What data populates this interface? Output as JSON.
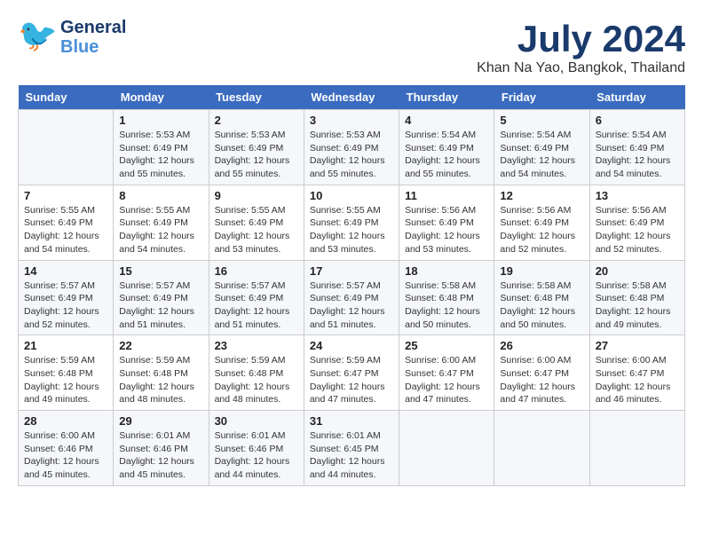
{
  "logo": {
    "line1": "General",
    "line2": "Blue"
  },
  "title": "July 2024",
  "subtitle": "Khan Na Yao, Bangkok, Thailand",
  "days_of_week": [
    "Sunday",
    "Monday",
    "Tuesday",
    "Wednesday",
    "Thursday",
    "Friday",
    "Saturday"
  ],
  "weeks": [
    [
      {
        "date": "",
        "sunrise": "",
        "sunset": "",
        "daylight": ""
      },
      {
        "date": "1",
        "sunrise": "Sunrise: 5:53 AM",
        "sunset": "Sunset: 6:49 PM",
        "daylight": "Daylight: 12 hours and 55 minutes."
      },
      {
        "date": "2",
        "sunrise": "Sunrise: 5:53 AM",
        "sunset": "Sunset: 6:49 PM",
        "daylight": "Daylight: 12 hours and 55 minutes."
      },
      {
        "date": "3",
        "sunrise": "Sunrise: 5:53 AM",
        "sunset": "Sunset: 6:49 PM",
        "daylight": "Daylight: 12 hours and 55 minutes."
      },
      {
        "date": "4",
        "sunrise": "Sunrise: 5:54 AM",
        "sunset": "Sunset: 6:49 PM",
        "daylight": "Daylight: 12 hours and 55 minutes."
      },
      {
        "date": "5",
        "sunrise": "Sunrise: 5:54 AM",
        "sunset": "Sunset: 6:49 PM",
        "daylight": "Daylight: 12 hours and 54 minutes."
      },
      {
        "date": "6",
        "sunrise": "Sunrise: 5:54 AM",
        "sunset": "Sunset: 6:49 PM",
        "daylight": "Daylight: 12 hours and 54 minutes."
      }
    ],
    [
      {
        "date": "7",
        "sunrise": "Sunrise: 5:55 AM",
        "sunset": "Sunset: 6:49 PM",
        "daylight": "Daylight: 12 hours and 54 minutes."
      },
      {
        "date": "8",
        "sunrise": "Sunrise: 5:55 AM",
        "sunset": "Sunset: 6:49 PM",
        "daylight": "Daylight: 12 hours and 54 minutes."
      },
      {
        "date": "9",
        "sunrise": "Sunrise: 5:55 AM",
        "sunset": "Sunset: 6:49 PM",
        "daylight": "Daylight: 12 hours and 53 minutes."
      },
      {
        "date": "10",
        "sunrise": "Sunrise: 5:55 AM",
        "sunset": "Sunset: 6:49 PM",
        "daylight": "Daylight: 12 hours and 53 minutes."
      },
      {
        "date": "11",
        "sunrise": "Sunrise: 5:56 AM",
        "sunset": "Sunset: 6:49 PM",
        "daylight": "Daylight: 12 hours and 53 minutes."
      },
      {
        "date": "12",
        "sunrise": "Sunrise: 5:56 AM",
        "sunset": "Sunset: 6:49 PM",
        "daylight": "Daylight: 12 hours and 52 minutes."
      },
      {
        "date": "13",
        "sunrise": "Sunrise: 5:56 AM",
        "sunset": "Sunset: 6:49 PM",
        "daylight": "Daylight: 12 hours and 52 minutes."
      }
    ],
    [
      {
        "date": "14",
        "sunrise": "Sunrise: 5:57 AM",
        "sunset": "Sunset: 6:49 PM",
        "daylight": "Daylight: 12 hours and 52 minutes."
      },
      {
        "date": "15",
        "sunrise": "Sunrise: 5:57 AM",
        "sunset": "Sunset: 6:49 PM",
        "daylight": "Daylight: 12 hours and 51 minutes."
      },
      {
        "date": "16",
        "sunrise": "Sunrise: 5:57 AM",
        "sunset": "Sunset: 6:49 PM",
        "daylight": "Daylight: 12 hours and 51 minutes."
      },
      {
        "date": "17",
        "sunrise": "Sunrise: 5:57 AM",
        "sunset": "Sunset: 6:49 PM",
        "daylight": "Daylight: 12 hours and 51 minutes."
      },
      {
        "date": "18",
        "sunrise": "Sunrise: 5:58 AM",
        "sunset": "Sunset: 6:48 PM",
        "daylight": "Daylight: 12 hours and 50 minutes."
      },
      {
        "date": "19",
        "sunrise": "Sunrise: 5:58 AM",
        "sunset": "Sunset: 6:48 PM",
        "daylight": "Daylight: 12 hours and 50 minutes."
      },
      {
        "date": "20",
        "sunrise": "Sunrise: 5:58 AM",
        "sunset": "Sunset: 6:48 PM",
        "daylight": "Daylight: 12 hours and 49 minutes."
      }
    ],
    [
      {
        "date": "21",
        "sunrise": "Sunrise: 5:59 AM",
        "sunset": "Sunset: 6:48 PM",
        "daylight": "Daylight: 12 hours and 49 minutes."
      },
      {
        "date": "22",
        "sunrise": "Sunrise: 5:59 AM",
        "sunset": "Sunset: 6:48 PM",
        "daylight": "Daylight: 12 hours and 48 minutes."
      },
      {
        "date": "23",
        "sunrise": "Sunrise: 5:59 AM",
        "sunset": "Sunset: 6:48 PM",
        "daylight": "Daylight: 12 hours and 48 minutes."
      },
      {
        "date": "24",
        "sunrise": "Sunrise: 5:59 AM",
        "sunset": "Sunset: 6:47 PM",
        "daylight": "Daylight: 12 hours and 47 minutes."
      },
      {
        "date": "25",
        "sunrise": "Sunrise: 6:00 AM",
        "sunset": "Sunset: 6:47 PM",
        "daylight": "Daylight: 12 hours and 47 minutes."
      },
      {
        "date": "26",
        "sunrise": "Sunrise: 6:00 AM",
        "sunset": "Sunset: 6:47 PM",
        "daylight": "Daylight: 12 hours and 47 minutes."
      },
      {
        "date": "27",
        "sunrise": "Sunrise: 6:00 AM",
        "sunset": "Sunset: 6:47 PM",
        "daylight": "Daylight: 12 hours and 46 minutes."
      }
    ],
    [
      {
        "date": "28",
        "sunrise": "Sunrise: 6:00 AM",
        "sunset": "Sunset: 6:46 PM",
        "daylight": "Daylight: 12 hours and 45 minutes."
      },
      {
        "date": "29",
        "sunrise": "Sunrise: 6:01 AM",
        "sunset": "Sunset: 6:46 PM",
        "daylight": "Daylight: 12 hours and 45 minutes."
      },
      {
        "date": "30",
        "sunrise": "Sunrise: 6:01 AM",
        "sunset": "Sunset: 6:46 PM",
        "daylight": "Daylight: 12 hours and 44 minutes."
      },
      {
        "date": "31",
        "sunrise": "Sunrise: 6:01 AM",
        "sunset": "Sunset: 6:45 PM",
        "daylight": "Daylight: 12 hours and 44 minutes."
      },
      {
        "date": "",
        "sunrise": "",
        "sunset": "",
        "daylight": ""
      },
      {
        "date": "",
        "sunrise": "",
        "sunset": "",
        "daylight": ""
      },
      {
        "date": "",
        "sunrise": "",
        "sunset": "",
        "daylight": ""
      }
    ]
  ]
}
